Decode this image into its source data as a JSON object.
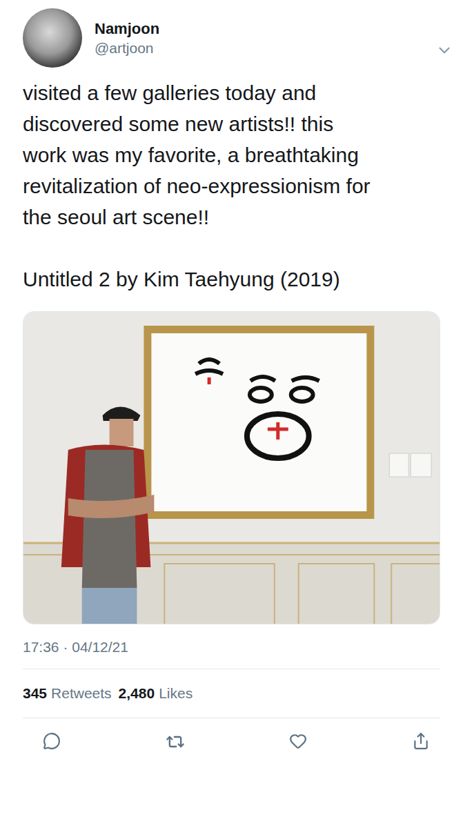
{
  "author": {
    "name": "Namjoon",
    "handle": "@artjoon"
  },
  "tweet": {
    "lines": [
      "visited a few galleries today and",
      "discovered some new artists!! this",
      "work was my favorite, a breathtaking",
      "revitalization of neo-expressionism for",
      "the seoul art scene!!"
    ],
    "caption": "Untitled 2 by Kim Taehyung (2019)"
  },
  "timestamp": "17:36 · 04/12/21",
  "stats": [
    {
      "count": "345",
      "label": "Retweets"
    },
    {
      "count": "2,480",
      "label": "Likes"
    }
  ]
}
